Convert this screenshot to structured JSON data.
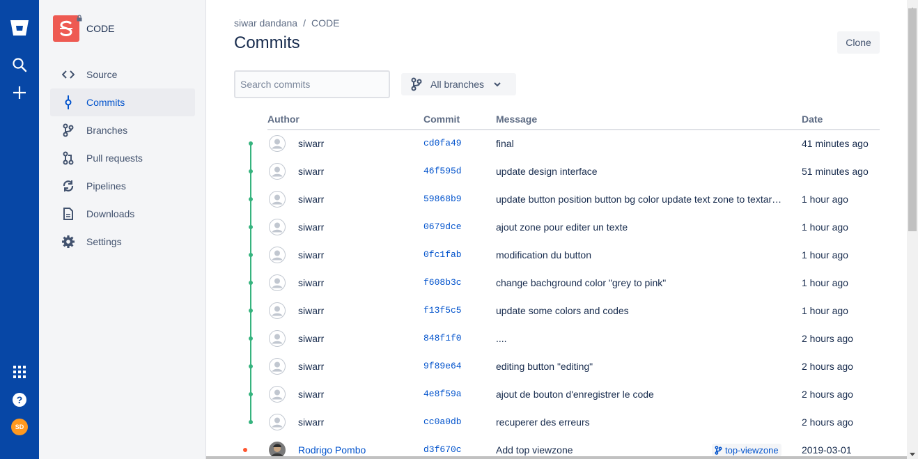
{
  "global_nav": {
    "avatar_initials": "SD"
  },
  "repo": {
    "name": "CODE"
  },
  "sidebar": {
    "items": [
      {
        "label": "Source",
        "icon": "code-icon"
      },
      {
        "label": "Commits",
        "icon": "commit-icon",
        "active": true
      },
      {
        "label": "Branches",
        "icon": "branch-icon"
      },
      {
        "label": "Pull requests",
        "icon": "pull-request-icon"
      },
      {
        "label": "Pipelines",
        "icon": "pipelines-icon"
      },
      {
        "label": "Downloads",
        "icon": "document-icon"
      },
      {
        "label": "Settings",
        "icon": "gear-icon"
      }
    ]
  },
  "breadcrumb": {
    "owner": "siwar dandana",
    "separator": "/",
    "repo": "CODE"
  },
  "page": {
    "title": "Commits",
    "clone_label": "Clone"
  },
  "search": {
    "placeholder": "Search commits",
    "value": ""
  },
  "branch_filter": {
    "label": "All branches"
  },
  "table": {
    "headers": {
      "author": "Author",
      "commit": "Commit",
      "message": "Message",
      "date": "Date"
    },
    "rows": [
      {
        "author": "siwarr",
        "hash": "cd0fa49",
        "message": "final",
        "date": "41 minutes ago"
      },
      {
        "author": "siwarr",
        "hash": "46f595d",
        "message": "update design interface",
        "date": "51 minutes ago"
      },
      {
        "author": "siwarr",
        "hash": "59868b9",
        "message": "update button position button bg color update text zone to textar…",
        "date": "1 hour ago"
      },
      {
        "author": "siwarr",
        "hash": "0679dce",
        "message": "ajout zone pour editer un texte",
        "date": "1 hour ago"
      },
      {
        "author": "siwarr",
        "hash": "0fc1fab",
        "message": "modification du button",
        "date": "1 hour ago"
      },
      {
        "author": "siwarr",
        "hash": "f608b3c",
        "message": "change bachground color \"grey to pink\"",
        "date": "1 hour ago"
      },
      {
        "author": "siwarr",
        "hash": "f13f5c5",
        "message": "update some colors and codes",
        "date": "1 hour ago"
      },
      {
        "author": "siwarr",
        "hash": "848f1f0",
        "message": "....",
        "date": "2 hours ago"
      },
      {
        "author": "siwarr",
        "hash": "9f89e64",
        "message": "editing button \"editing\"",
        "date": "2 hours ago"
      },
      {
        "author": "siwarr",
        "hash": "4e8f59a",
        "message": "ajout de bouton d'enregistrer le code",
        "date": "2 hours ago"
      },
      {
        "author": "siwarr",
        "hash": "cc0a0db",
        "message": "recuperer des erreurs",
        "date": "2 hours ago"
      },
      {
        "author": "Rodrigo Pombo",
        "hash": "d3f670c",
        "message": "Add top viewzone",
        "branch_tag": "top-viewzone",
        "date": "2019-03-01"
      }
    ]
  }
}
